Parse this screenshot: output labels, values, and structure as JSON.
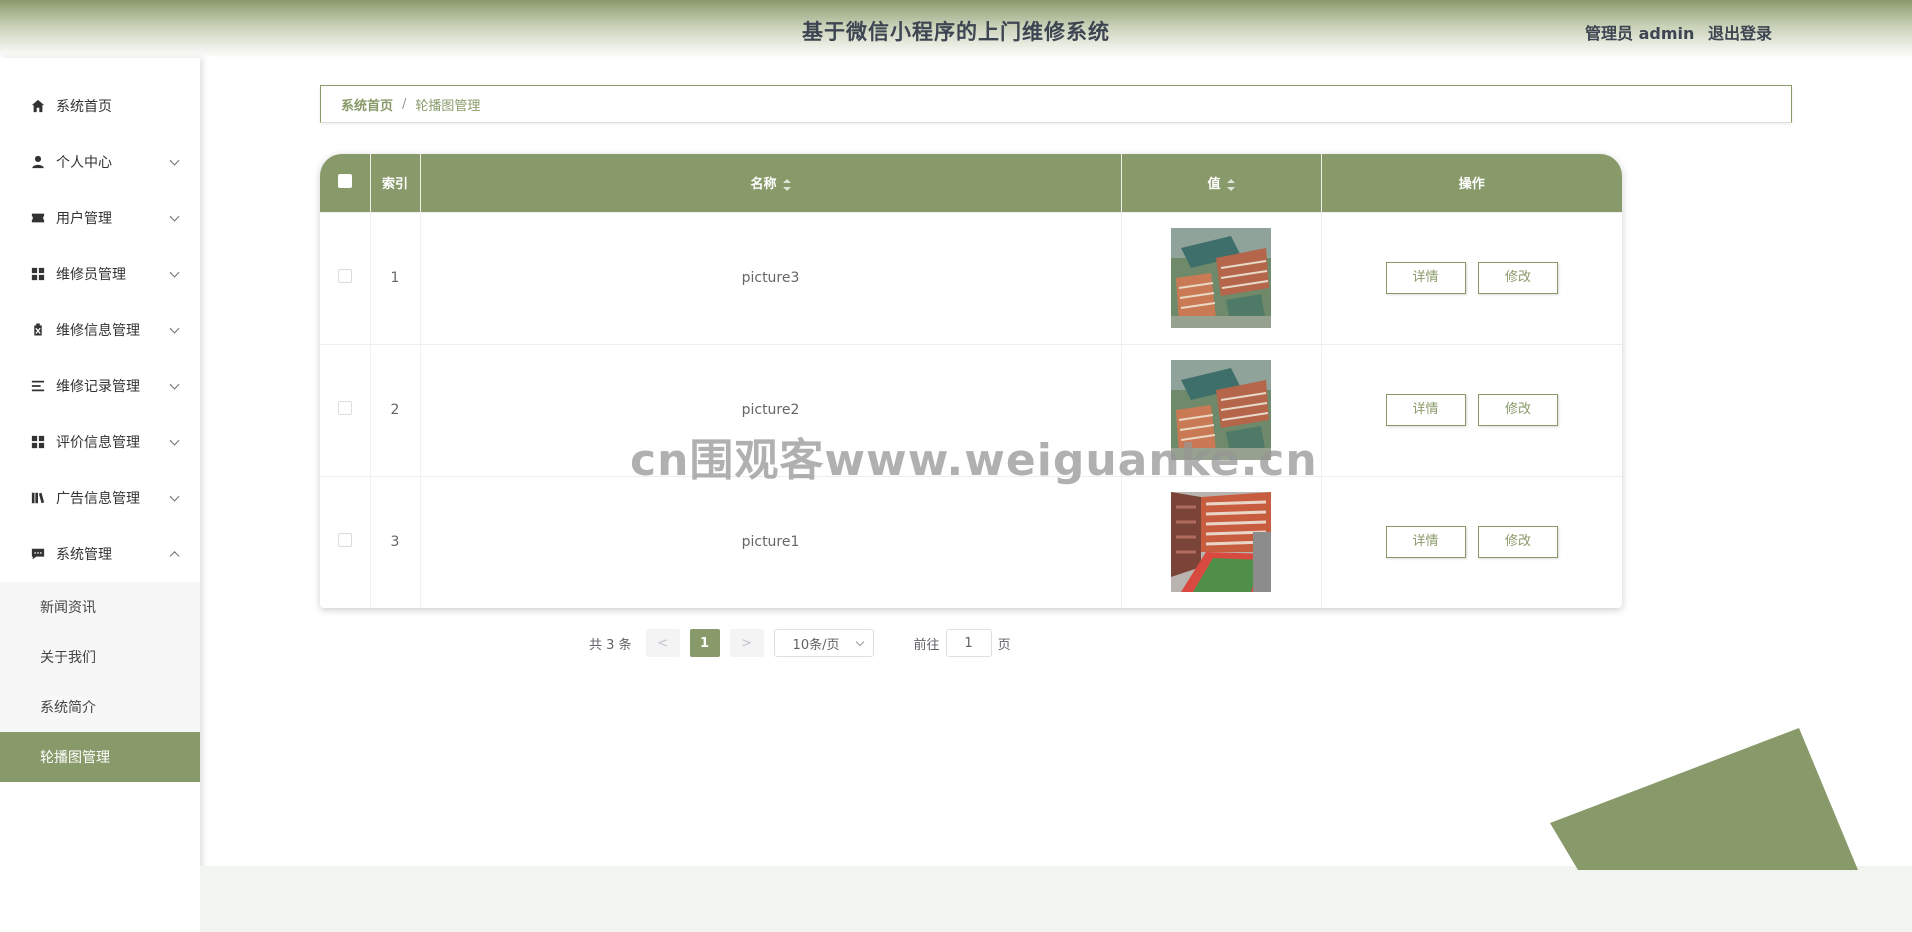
{
  "header": {
    "title": "基于微信小程序的上门维修系统",
    "user_label": "管理员 admin",
    "logout_label": "退出登录"
  },
  "sidebar": {
    "items": [
      {
        "label": "系统首页",
        "icon": "home-icon"
      },
      {
        "label": "个人中心",
        "icon": "person-icon"
      },
      {
        "label": "用户管理",
        "icon": "ticket-icon"
      },
      {
        "label": "维修员管理",
        "icon": "grid-icon"
      },
      {
        "label": "维修信息管理",
        "icon": "clipboard-x-icon"
      },
      {
        "label": "维修记录管理",
        "icon": "list-icon"
      },
      {
        "label": "评价信息管理",
        "icon": "grid-icon"
      },
      {
        "label": "广告信息管理",
        "icon": "books-icon"
      },
      {
        "label": "系统管理",
        "icon": "chat-icon"
      }
    ],
    "submenu": [
      "新闻资讯",
      "关于我们",
      "系统简介",
      "轮播图管理"
    ],
    "active_sub": "轮播图管理"
  },
  "breadcrumb": {
    "home": "系统首页",
    "separator": "/",
    "current": "轮播图管理"
  },
  "table": {
    "headers": {
      "index": "索引",
      "name": "名称",
      "value": "值",
      "actions": "操作"
    },
    "rows": [
      {
        "index": "1",
        "name": "picture3",
        "image": "campus-aerial"
      },
      {
        "index": "2",
        "name": "picture2",
        "image": "campus-aerial"
      },
      {
        "index": "3",
        "name": "picture1",
        "image": "campus-track"
      }
    ],
    "detail_label": "详情",
    "edit_label": "修改"
  },
  "pagination": {
    "total_label": "共 3 条",
    "prev": "<",
    "next": ">",
    "current_page": "1",
    "page_size": "10条/页",
    "goto_prefix": "前往",
    "goto_value": "1",
    "goto_suffix": "页"
  },
  "watermark": "cn围观客www.weiguanke.cn",
  "colors": {
    "accent": "#889a6a",
    "header_text": "#3d4552"
  }
}
